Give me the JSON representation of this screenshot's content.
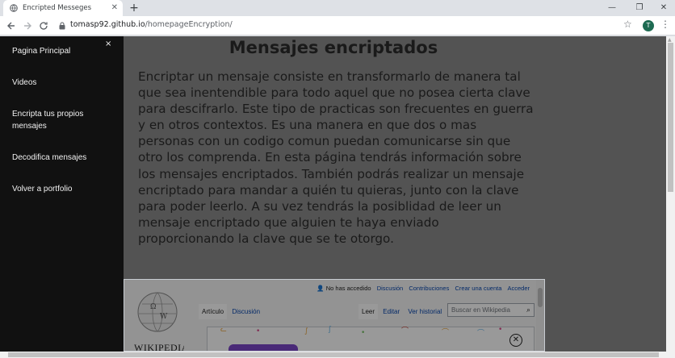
{
  "browser": {
    "tab_title": "Encripted Messeges",
    "tab_close": "✕",
    "new_tab": "+",
    "url_host": "tomasp92.github.io",
    "url_path": "/homepageEncryption/",
    "window_controls": [
      "—",
      "❐",
      "✕"
    ],
    "profile_initial": "T",
    "icons": [
      "back-arrow-icon",
      "forward-arrow-icon",
      "reload-icon",
      "lock-icon",
      "star-icon",
      "kebab-menu-icon"
    ]
  },
  "sidebar": {
    "close": "×",
    "items": [
      {
        "label": "Pagina Principal"
      },
      {
        "label": "Videos"
      },
      {
        "label": "Encripta tus propios mensajes"
      },
      {
        "label": "Decodifica mensajes"
      },
      {
        "label": "Volver a portfolio"
      }
    ]
  },
  "main": {
    "title": "Mensajes encriptados",
    "intro": "Encriptar un mensaje consiste en transformarlo de manera tal que sea inentendible para todo aquel que no posea cierta clave para descifrarlo. Este tipo de practicas son frecuentes en guerra y en otros contextos. Es una manera en que dos o mas personas con un codigo comun puedan comunicarse sin que otro los comprenda. En esta página tendrás información sobre los mensajes encriptados. También podrás realizar un mensaje encriptado para mandar a quién tu quieras, junto con la clave para poder leerlo. A su vez tendrás la posiblidad de leer un mensaje encriptado que alguien te haya enviado proporcionando la clave que se te otorgo."
  },
  "wikipedia": {
    "user_status": "No has accedido",
    "user_links": [
      "Discusión",
      "Contribuciones",
      "Crear una cuenta",
      "Acceder"
    ],
    "tabs": [
      "Artículo",
      "Discusión"
    ],
    "right_tabs": [
      "Leer",
      "Editar",
      "Ver historial"
    ],
    "search_placeholder": "Buscar en Wikipedia",
    "logo_text": "Wikipedia",
    "banner_close": "✕"
  },
  "colors": {
    "sidebar_bg": "#111111",
    "overlay": "rgba(0,0,0,0.4)",
    "wiki_link": "#0645ad",
    "wiki_button": "#7a45c6"
  }
}
